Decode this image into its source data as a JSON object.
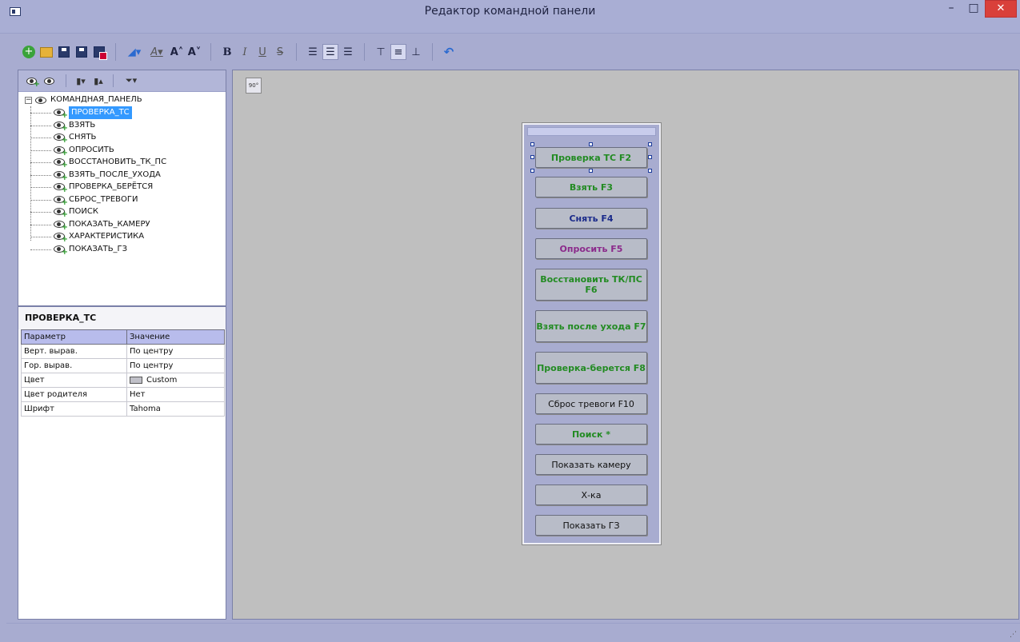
{
  "window": {
    "title": "Редактор командной панели",
    "min_glyph": "–",
    "max_glyph": "□",
    "close_glyph": "✕"
  },
  "toolbar": {
    "icons": [
      "add-icon",
      "open-folder-icon",
      "save-icon",
      "save-all-icon",
      "delete-icon",
      "fill-color-icon",
      "font-color-icon",
      "font-increase-icon",
      "font-decrease-icon",
      "bold-icon",
      "italic-icon",
      "underline-icon",
      "strikethrough-icon",
      "align-left-icon",
      "align-center-icon",
      "align-right-icon",
      "align-top-icon",
      "align-middle-icon",
      "align-bottom-icon",
      "undo-icon"
    ],
    "bold_glyph": "B",
    "italic_glyph": "I",
    "underline_glyph": "U",
    "strike_glyph": "S"
  },
  "tree": {
    "root": "КОМАНДНАЯ_ПАНЕЛЬ",
    "items": [
      "ПРОВЕРКА_ТС",
      "ВЗЯТЬ",
      "СНЯТЬ",
      "ОПРОСИТЬ",
      "ВОССТАНОВИТЬ_ТК_ПС",
      "ВЗЯТЬ_ПОСЛЕ_УХОДА",
      "ПРОВЕРКА_БЕРЁТСЯ",
      "СБРОС_ТРЕВОГИ",
      "ПОИСК",
      "ПОКАЗАТЬ_КАМЕРУ",
      "ХАРАКТЕРИСТИКА",
      "ПОКАЗАТЬ_ГЗ"
    ],
    "selected_index": 0
  },
  "properties": {
    "title": "ПРОВЕРКА_ТС",
    "col_param": "Параметр",
    "col_value": "Значение",
    "rows": [
      {
        "param": "Верт. вырав.",
        "value": "По центру"
      },
      {
        "param": "Гор. вырав.",
        "value": "По центру"
      },
      {
        "param": "Цвет",
        "value": "Custom"
      },
      {
        "param": "Цвет родителя",
        "value": "Нет"
      },
      {
        "param": "Шрифт",
        "value": "Tahoma"
      }
    ]
  },
  "panel": {
    "buttons": [
      {
        "label": "Проверка ТС F2",
        "style": "green"
      },
      {
        "label": "Взять F3",
        "style": "green"
      },
      {
        "label": "Снять F4",
        "style": "navy"
      },
      {
        "label": "Опросить F5",
        "style": "purple"
      },
      {
        "label": "Восстановить ТК/ПС F6",
        "style": "green"
      },
      {
        "label": "Взять после ухода F7",
        "style": "green"
      },
      {
        "label": "Проверка-берется F8",
        "style": "green"
      },
      {
        "label": "Сброс тревоги F10",
        "style": "normal"
      },
      {
        "label": "Поиск *",
        "style": "green"
      },
      {
        "label": "Показать камеру",
        "style": "normal"
      },
      {
        "label": "Х-ка",
        "style": "normal"
      },
      {
        "label": "Показать ГЗ",
        "style": "normal"
      }
    ]
  },
  "colors": {
    "accent": "#3399ff",
    "green_text": "#228b22",
    "navy_text": "#1a2a8a",
    "purple_text": "#8b2a8b",
    "close_button": "#d9403a"
  }
}
